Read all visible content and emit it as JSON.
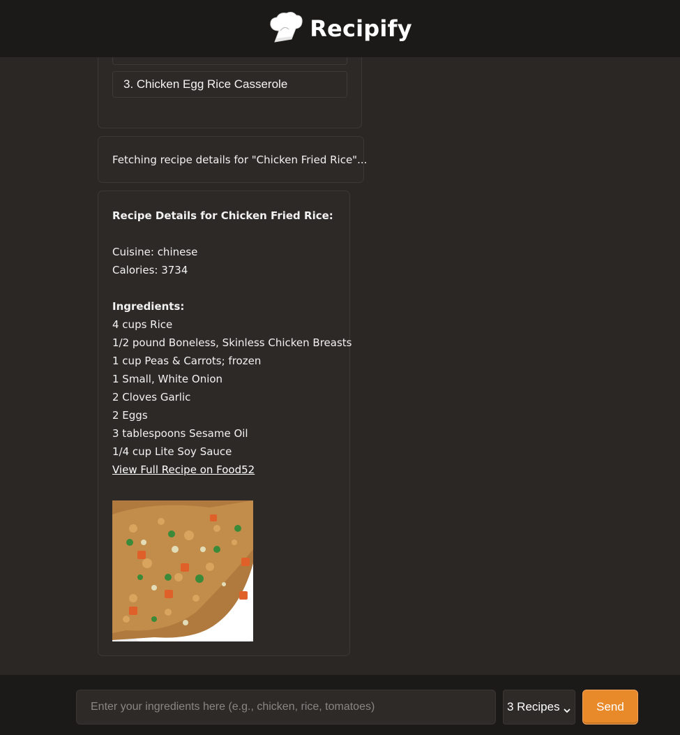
{
  "header": {
    "title": "Recipify",
    "logo_icon": "chef-hat-icon"
  },
  "chat": {
    "recipe_options": [
      {
        "label": ""
      },
      {
        "label": "3. Chicken Egg Rice Casserole"
      }
    ],
    "status_message": "Fetching recipe details for \"Chicken Fried Rice\"...",
    "details": {
      "heading": "Recipe Details for Chicken Fried Rice:",
      "cuisine": "Cuisine: chinese",
      "calories": "Calories: 3734",
      "ingredients_heading": "Ingredients:",
      "ingredients": [
        "4 cups Rice",
        "1/2 pound Boneless, Skinless Chicken Breasts",
        "1 cup Peas & Carrots; frozen",
        "1 Small, White Onion",
        "2 Cloves Garlic",
        "2 Eggs",
        "3 tablespoons Sesame Oil",
        "1/4 cup Lite Soy Sauce"
      ],
      "link_text": "View Full Recipe on Food52",
      "image_alt": "Chicken fried rice photo"
    }
  },
  "footer": {
    "input_placeholder": "Enter your ingredients here (e.g., chicken, rice, tomatoes)",
    "input_value": "",
    "recipe_count_selected": "3 Recipes",
    "send_label": "Send"
  },
  "colors": {
    "background": "#2b2725",
    "header_bg": "#1b1a19",
    "card_bg": "#2d2927",
    "accent": "#e8892a"
  }
}
